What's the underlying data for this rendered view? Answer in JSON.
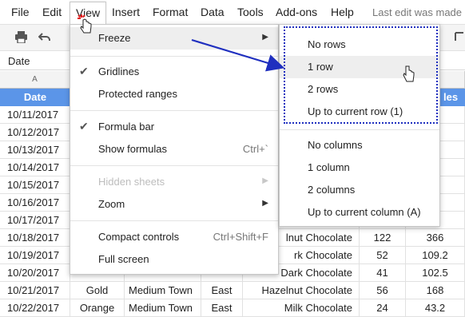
{
  "menubar": {
    "items": [
      "File",
      "Edit",
      "View",
      "Insert",
      "Format",
      "Data",
      "Tools",
      "Add-ons",
      "Help"
    ],
    "last_edit": "Last edit was made"
  },
  "toolbar": {
    "icons": [
      "print-icon",
      "undo-icon",
      "redo-icon"
    ]
  },
  "formula_bar": {
    "cell_value": "Date"
  },
  "column_headers": [
    "A"
  ],
  "sheet": {
    "headers": {
      "date": "Date",
      "sales": "les"
    },
    "rows": [
      {
        "date": "10/11/2017",
        "color": "",
        "town": "",
        "region": "",
        "product": "",
        "qty": "",
        "sales": ""
      },
      {
        "date": "10/12/2017",
        "color": "",
        "town": "",
        "region": "",
        "product": "",
        "qty": "",
        "sales": "1"
      },
      {
        "date": "10/13/2017",
        "color": "",
        "town": "",
        "region": "",
        "product": "",
        "qty": "",
        "sales": "2"
      },
      {
        "date": "10/14/2017",
        "color": "",
        "town": "",
        "region": "",
        "product": "",
        "qty": "",
        "sales": ""
      },
      {
        "date": "10/15/2017",
        "color": "",
        "town": "",
        "region": "",
        "product": "",
        "qty": "",
        "sales": "8"
      },
      {
        "date": "10/16/2017",
        "color": "",
        "town": "",
        "region": "",
        "product": "",
        "qty": "",
        "sales": ""
      },
      {
        "date": "10/17/2017",
        "color": "",
        "town": "",
        "region": "",
        "product": "",
        "qty": "",
        "sales": ""
      },
      {
        "date": "10/18/2017",
        "color": "",
        "town": "",
        "region": "",
        "product": "lnut Chocolate",
        "qty": "122",
        "sales": "366"
      },
      {
        "date": "10/19/2017",
        "color": "",
        "town": "",
        "region": "",
        "product": "rk Chocolate",
        "qty": "52",
        "sales": "109.2"
      },
      {
        "date": "10/20/2017",
        "color": "",
        "town": "",
        "region": "",
        "product": "Dark Chocolate",
        "qty": "41",
        "sales": "102.5"
      },
      {
        "date": "10/21/2017",
        "color": "Gold",
        "town": "Medium Town",
        "region": "East",
        "product": "Hazelnut Chocolate",
        "qty": "56",
        "sales": "168"
      },
      {
        "date": "10/22/2017",
        "color": "Orange",
        "town": "Medium Town",
        "region": "East",
        "product": "Milk Chocolate",
        "qty": "24",
        "sales": "43.2"
      }
    ]
  },
  "view_menu": {
    "freeze": "Freeze",
    "gridlines": "Gridlines",
    "protected_ranges": "Protected ranges",
    "formula_bar": "Formula bar",
    "show_formulas": "Show formulas",
    "show_formulas_shortcut": "Ctrl+`",
    "hidden_sheets": "Hidden sheets",
    "zoom": "Zoom",
    "compact_controls": "Compact controls",
    "compact_controls_shortcut": "Ctrl+Shift+F",
    "full_screen": "Full screen"
  },
  "freeze_submenu": {
    "no_rows": "No rows",
    "one_row": "1 row",
    "two_rows": "2 rows",
    "up_to_row": "Up to current row (1)",
    "no_columns": "No columns",
    "one_column": "1 column",
    "two_columns": "2 columns",
    "up_to_column": "Up to current column (A)"
  },
  "colors": {
    "header_blue": "#5b95e8",
    "annotation_blue": "#1f2fbf",
    "cursor_red": "#e02020"
  }
}
